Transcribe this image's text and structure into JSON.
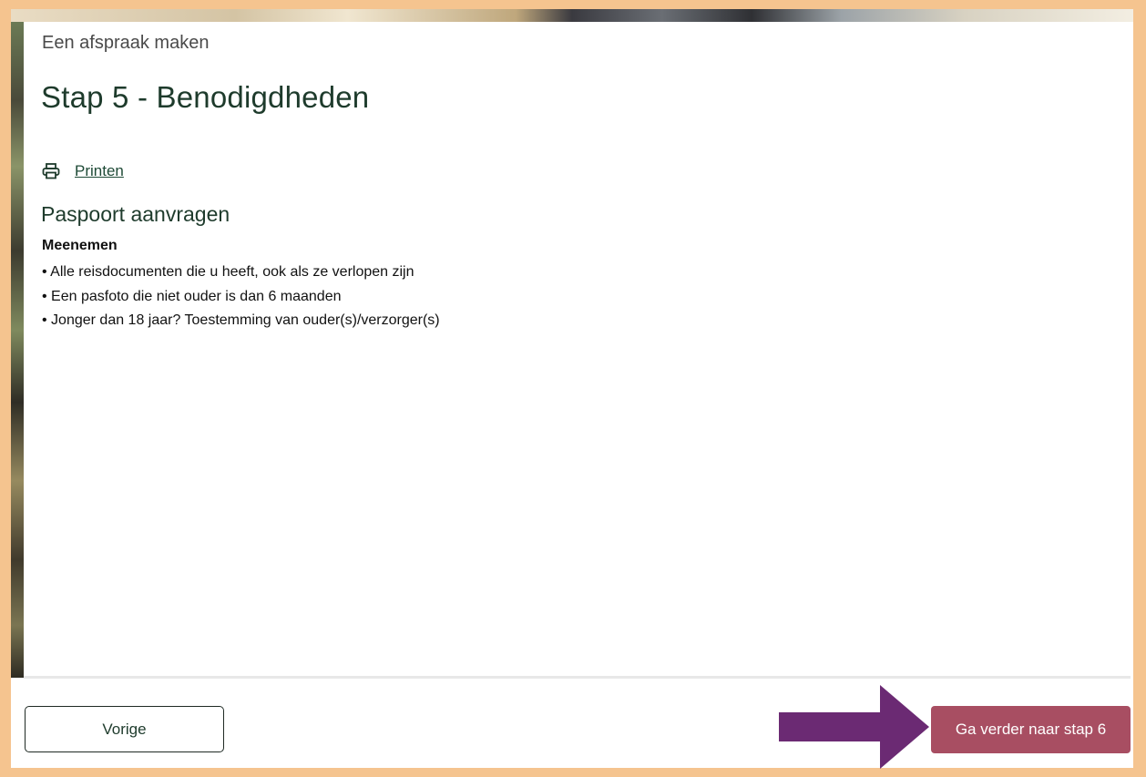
{
  "header": {
    "kicker": "Een afspraak maken",
    "title": "Stap 5 - Benodigdheden"
  },
  "print": {
    "icon": "printer-icon",
    "label": "Printen"
  },
  "section": {
    "title": "Paspoort aanvragen",
    "subheading": "Meenemen",
    "items": [
      "• Alle reisdocumenten die u heeft, ook als ze verlopen zijn",
      "• Een pasfoto die niet ouder is dan 6 maanden",
      "• Jonger dan 18 jaar? Toestemming van ouder(s)/verzorger(s)"
    ]
  },
  "footer": {
    "prev_label": "Vorige",
    "next_label": "Ga verder naar stap 6"
  },
  "colors": {
    "border": "#f5c48f",
    "accent": "#a84e62",
    "heading": "#1e3b2c",
    "arrow": "#6b2a73"
  }
}
